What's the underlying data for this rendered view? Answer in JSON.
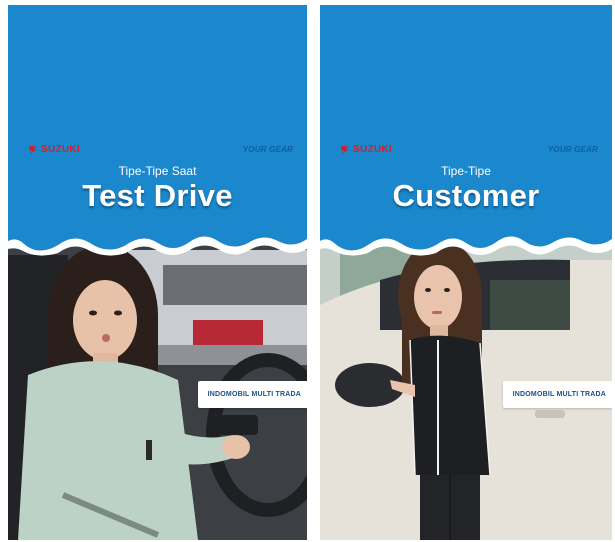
{
  "cards": [
    {
      "brand": "SUZUKI",
      "tagline": "YOUR GEAR",
      "subtitle": "Tipe-Tipe Saat",
      "title": "Test Drive",
      "badge": "INDOMOBIL MULTI TRADA"
    },
    {
      "brand": "SUZUKI",
      "tagline": "YOUR GEAR",
      "subtitle": "Tipe-Tipe",
      "title": "Customer",
      "badge": "INDOMOBIL MULTI TRADA"
    }
  ],
  "colors": {
    "banner_blue": "#1b87cc",
    "brand_red": "#d4202a",
    "badge_text": "#1a4f8a"
  }
}
